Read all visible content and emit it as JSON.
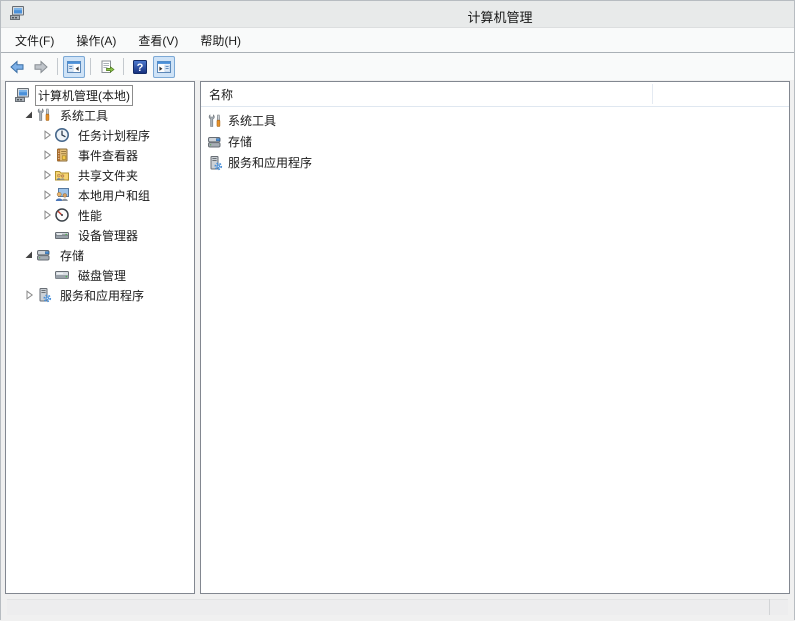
{
  "window": {
    "title": "计算机管理",
    "app_icon": "computer-management-icon"
  },
  "colors": {
    "titlebar_bg": "#e8eaea",
    "toolbar_toggle_active_bg": "#cfe3f7",
    "toolbar_toggle_active_border": "#7ca9d6",
    "panel_border": "#828790",
    "accent_blue": "#4a90d9"
  },
  "menu": {
    "items": [
      {
        "id": "file",
        "label": "文件(F)"
      },
      {
        "id": "action",
        "label": "操作(A)"
      },
      {
        "id": "view",
        "label": "查看(V)"
      },
      {
        "id": "help",
        "label": "帮助(H)"
      }
    ]
  },
  "toolbar": {
    "buttons": [
      {
        "id": "back",
        "icon": "back-arrow-icon",
        "state": "enabled"
      },
      {
        "id": "forward",
        "icon": "forward-arrow-icon",
        "state": "disabled"
      },
      {
        "id": "sep1",
        "separator": true
      },
      {
        "id": "console-tree",
        "icon": "console-tree-icon",
        "state": "active"
      },
      {
        "id": "sep2",
        "separator": true
      },
      {
        "id": "export-list",
        "icon": "export-list-icon",
        "state": "enabled"
      },
      {
        "id": "sep3",
        "separator": true
      },
      {
        "id": "help",
        "icon": "help-icon",
        "state": "enabled"
      },
      {
        "id": "action-pane",
        "icon": "action-pane-icon",
        "state": "active"
      }
    ]
  },
  "tree": {
    "items": [
      {
        "id": "computer-management-local",
        "label": "计算机管理(本地)",
        "level": 0,
        "expand": "none",
        "icon": "computer-icon",
        "selected": true
      },
      {
        "id": "system-tools",
        "label": "系统工具",
        "level": 1,
        "expand": "expanded",
        "icon": "tools-icon"
      },
      {
        "id": "task-scheduler",
        "label": "任务计划程序",
        "level": 2,
        "expand": "collapsed",
        "icon": "task-scheduler-icon"
      },
      {
        "id": "event-viewer",
        "label": "事件查看器",
        "level": 2,
        "expand": "collapsed",
        "icon": "event-viewer-icon"
      },
      {
        "id": "shared-folders",
        "label": "共享文件夹",
        "level": 2,
        "expand": "collapsed",
        "icon": "shared-folders-icon"
      },
      {
        "id": "local-users-groups",
        "label": "本地用户和组",
        "level": 2,
        "expand": "collapsed",
        "icon": "users-icon"
      },
      {
        "id": "performance",
        "label": "性能",
        "level": 2,
        "expand": "collapsed",
        "icon": "performance-icon"
      },
      {
        "id": "device-manager",
        "label": "设备管理器",
        "level": 2,
        "expand": "none",
        "icon": "device-manager-icon"
      },
      {
        "id": "storage",
        "label": "存储",
        "level": 1,
        "expand": "expanded",
        "icon": "storage-icon"
      },
      {
        "id": "disk-management",
        "label": "磁盘管理",
        "level": 2,
        "expand": "none",
        "icon": "disk-management-icon"
      },
      {
        "id": "services-applications",
        "label": "服务和应用程序",
        "level": 1,
        "expand": "collapsed",
        "icon": "services-icon"
      }
    ]
  },
  "list": {
    "columns": [
      {
        "id": "name",
        "label": "名称"
      }
    ],
    "items": [
      {
        "id": "system-tools",
        "label": "系统工具",
        "icon": "tools-icon"
      },
      {
        "id": "storage",
        "label": "存储",
        "icon": "storage-icon"
      },
      {
        "id": "services-applications",
        "label": "服务和应用程序",
        "icon": "services-icon"
      }
    ]
  }
}
